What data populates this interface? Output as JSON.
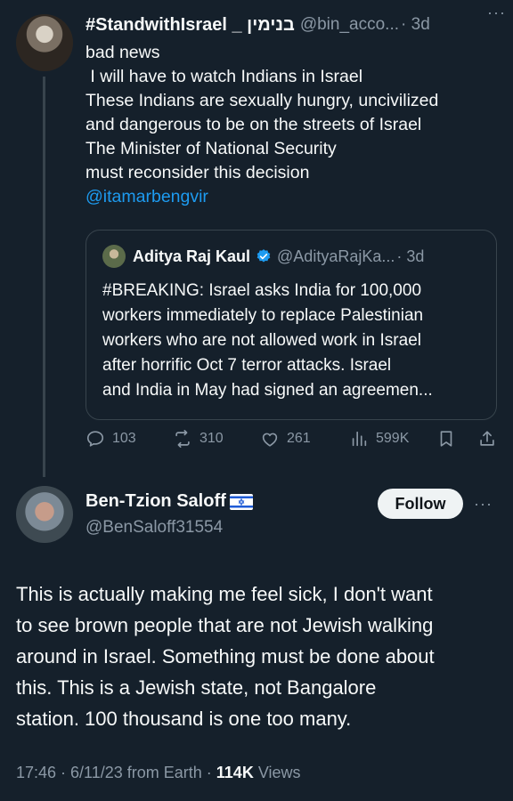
{
  "parent_tweet": {
    "display_name": "#StandwithIsrael _ בנימין",
    "handle": "@bin_acco...",
    "time": "· 3d",
    "more": "···",
    "lines": [
      "bad news",
      " I will have to watch Indians in Israel",
      "These Indians are sexually hungry, uncivilized",
      "and dangerous to be on the streets of Israel",
      "The Minister of National Security",
      "must reconsider this decision"
    ],
    "mention": "@itamarbengvir",
    "quote": {
      "display_name": "Aditya Raj Kaul",
      "handle": "@AdityaRajKa...",
      "time": "· 3d",
      "lines": [
        "#BREAKING: Israel asks India for 100,000",
        "workers immediately to replace Palestinian",
        "workers who are not allowed work in Israel",
        "after horrific Oct 7 terror attacks. Israel",
        "and India in May had signed an agreemen..."
      ]
    },
    "actions": {
      "replies": "103",
      "retweets": "310",
      "likes": "261",
      "views": "599K"
    }
  },
  "main_tweet": {
    "display_name": "Ben-Tzion Saloff",
    "handle": "@BenSaloff31554",
    "follow_label": "Follow",
    "more": "···",
    "lines": [
      "This is actually making me feel sick, I don't want",
      "to see brown people that are not Jewish walking",
      "around in Israel. Something must be done about",
      "this. This is a Jewish state, not Bangalore",
      "station. 100 thousand is one too many."
    ],
    "meta_prefix": "17:46 · 6/11/23 from Earth · ",
    "views_count": "114K",
    "views_label": " Views"
  },
  "icons": [
    "reply-icon",
    "retweet-icon",
    "like-icon",
    "views-icon",
    "bookmark-icon",
    "share-icon",
    "verified-icon",
    "israel-flag-icon"
  ],
  "colors": {
    "background": "#15202b",
    "text": "#f7f9f9",
    "muted": "#8b98a5",
    "link": "#1d9bf0",
    "border": "#38444d",
    "follow_bg": "#eff3f4"
  }
}
